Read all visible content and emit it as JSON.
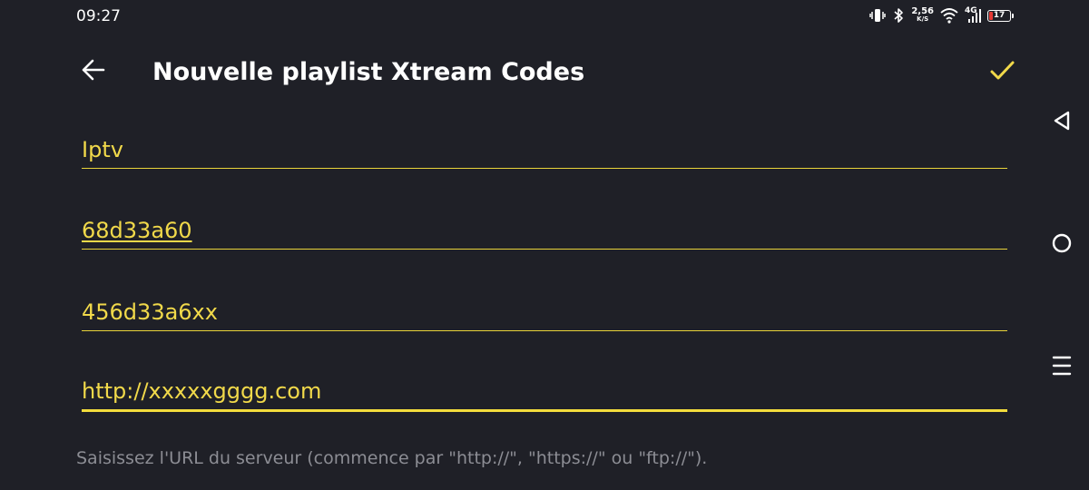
{
  "status_bar": {
    "time": "09:27",
    "speed_value": "2,56",
    "speed_unit": "K/S",
    "network_label": "4G",
    "battery_level": "17",
    "battery_percent": 17,
    "icons": [
      "vibrate-icon",
      "bluetooth-icon",
      "wifi-icon",
      "cell-signal-icon",
      "battery-icon"
    ]
  },
  "toolbar": {
    "back_icon": "arrow-left-icon",
    "title": "Nouvelle playlist Xtream Codes",
    "confirm_icon": "check-icon"
  },
  "form": {
    "fields": [
      {
        "value": "Iptv",
        "placeholder": ""
      },
      {
        "value": "68d33a60",
        "placeholder": ""
      },
      {
        "value": "456d33a6xx",
        "placeholder": ""
      },
      {
        "value": "http://xxxxxgggg.com",
        "placeholder": ""
      }
    ],
    "helper_text": "Saisissez l'URL du serveur (commence par \"http://\", \"https://\" ou \"ftp://\")."
  },
  "nav_bar": {
    "items": [
      "triangle-back-icon",
      "circle-home-icon",
      "menu-lines-icon"
    ]
  },
  "colors": {
    "background": "#1f2027",
    "accent": "#f1d94a",
    "title": "#ffffff",
    "helper": "#8c8d94",
    "battery_low": "#e53935"
  }
}
